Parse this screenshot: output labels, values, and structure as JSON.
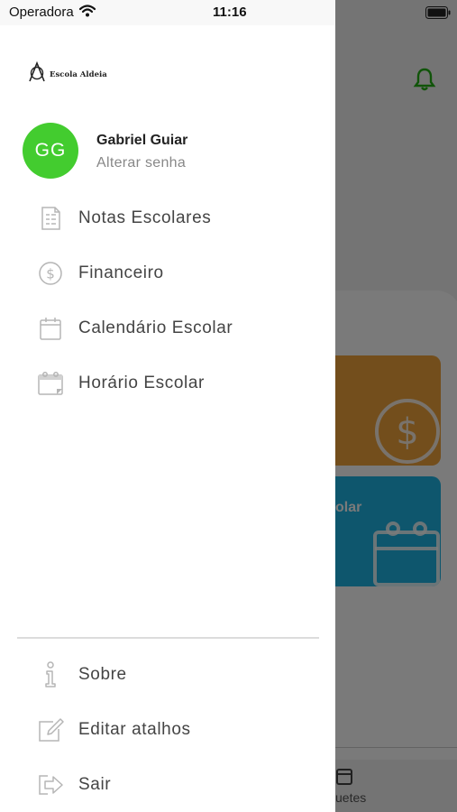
{
  "status_bar": {
    "carrier": "Operadora",
    "time": "11:16"
  },
  "drawer": {
    "logo_text": "Escola Aldeia",
    "user": {
      "initials": "GG",
      "name": "Gabriel Guiar",
      "action": "Alterar senha"
    },
    "menu": [
      {
        "label": "Notas Escolares",
        "icon": "report-card-icon"
      },
      {
        "label": "Financeiro",
        "icon": "dollar-coin-icon"
      },
      {
        "label": "Calendário Escolar",
        "icon": "calendar-icon"
      },
      {
        "label": "Horário Escolar",
        "icon": "schedule-calendar-icon"
      }
    ],
    "footer_menu": [
      {
        "label": "Sobre",
        "icon": "info-icon"
      },
      {
        "label": "Editar atalhos",
        "icon": "edit-icon"
      },
      {
        "label": "Sair",
        "icon": "logout-icon"
      }
    ]
  },
  "background": {
    "card_blue_title": "olar",
    "tab_label": "uetes"
  },
  "colors": {
    "accent_green": "#43cc2f",
    "card_orange": "#f0a43c",
    "card_blue": "#1fb3e4",
    "icon_gray": "#b5b5b5"
  }
}
